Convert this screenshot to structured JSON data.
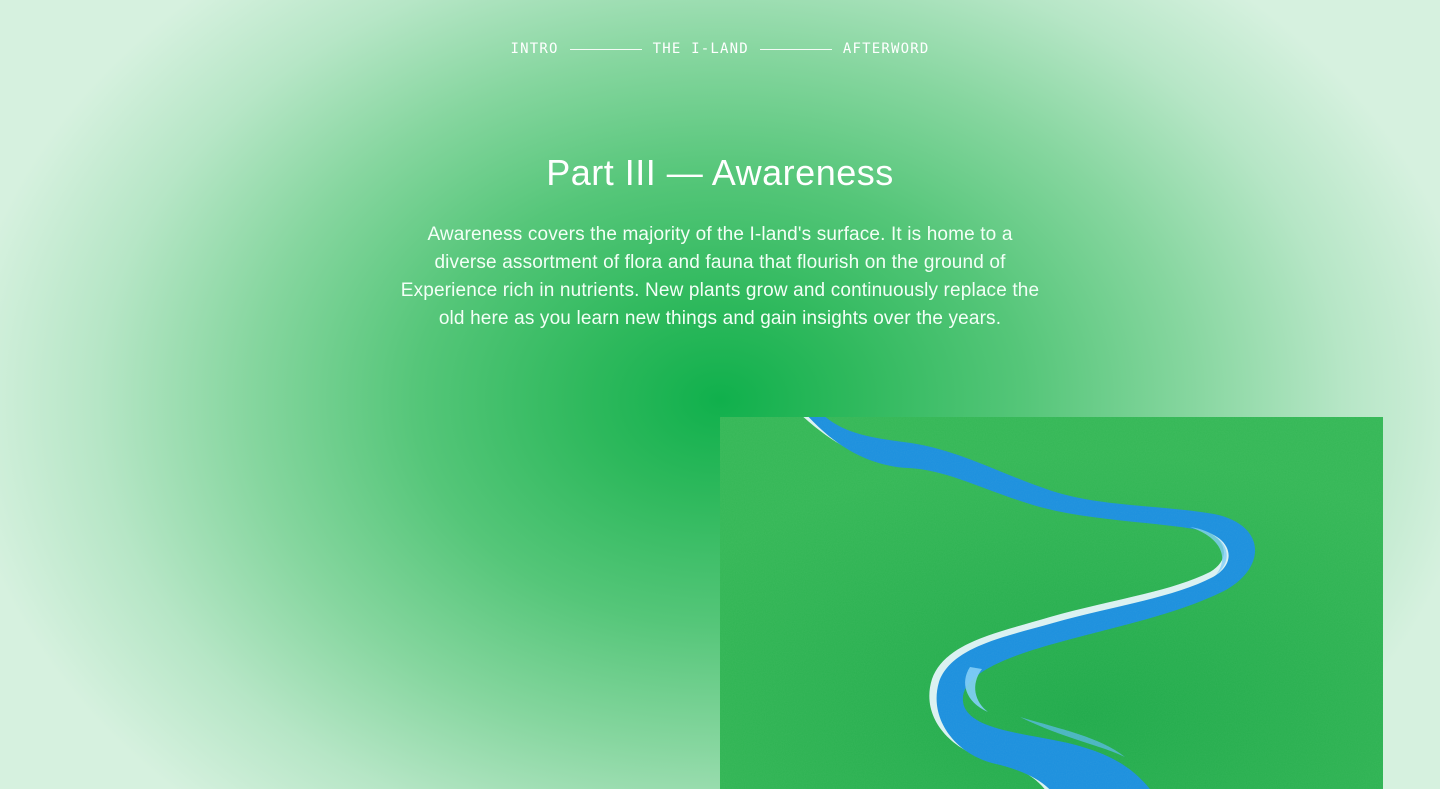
{
  "nav": {
    "items": [
      {
        "label": "INTRO"
      },
      {
        "label": "THE I-LAND"
      },
      {
        "label": "AFTERWORD"
      }
    ]
  },
  "section": {
    "title": "Part III — Awareness",
    "description": "Awareness covers the majority of the I-land's surface. It is home to a diverse assortment of flora and fauna that flourish on the ground of Experience rich in nutrients. New plants grow and continuously replace the old here as you learn new things and gain insights over the years."
  },
  "colors": {
    "center_green": "#10b04c",
    "edge_green": "#d6f1df",
    "land_green": "#2fb552",
    "river_blue": "#1a93e0",
    "river_light": "#4fb6f2"
  }
}
